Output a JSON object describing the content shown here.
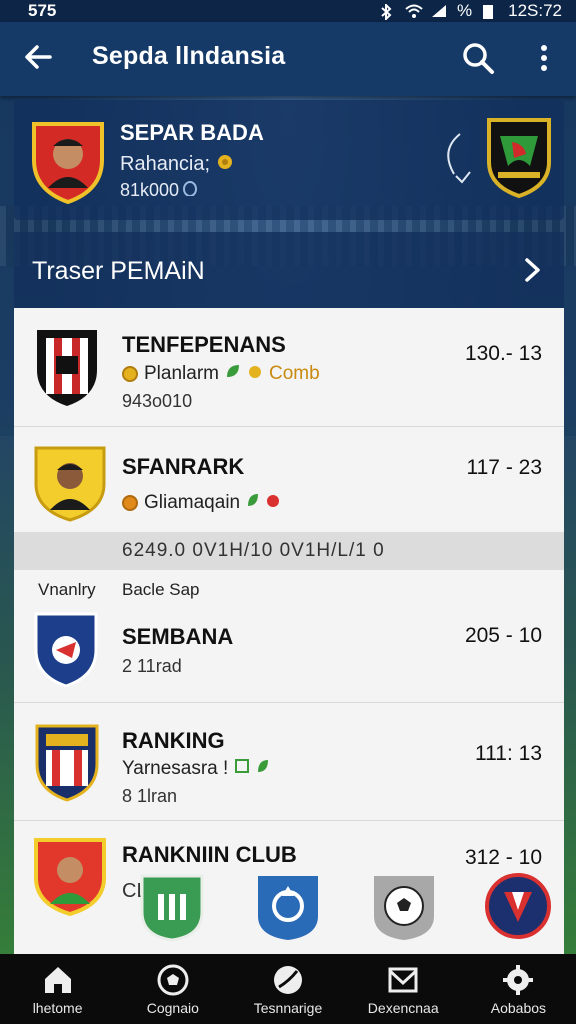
{
  "status_bar": {
    "left": "575",
    "battery_pct": "%",
    "time": "12S:72"
  },
  "app_bar": {
    "title": "Sepda llndansia"
  },
  "featured_match": {
    "team_name": "SEPAR BADA",
    "subtitle": "Rahancia;",
    "meta": "81k000"
  },
  "section": {
    "label": "Traser PEMAiN"
  },
  "list": [
    {
      "name": "TENFEPENANS",
      "sub_a": "Planlarm",
      "sub_b": "Comb",
      "meta": "943o010",
      "score": "130.- 13"
    },
    {
      "name": "SFANRARK",
      "sub_a": "Gliamaqain",
      "score": "117 - 23"
    }
  ],
  "strip_text": "6249.0   0V1H/10   0V1H/L/1 0",
  "column_headers": {
    "left": "Vnanlry",
    "right": "Bacle Sap"
  },
  "list_lower": [
    {
      "name": "SEMBANA",
      "meta": "2 11rad",
      "score": "205 - 10"
    },
    {
      "name": "RANKING",
      "sub_a": "Yarnesasra !",
      "meta": "8 1lran",
      "score": "111: 13"
    },
    {
      "name": "RANKNIIN CLUB",
      "meta": "CL",
      "score": "312 - 10"
    }
  ],
  "bottom_nav": [
    {
      "label": "lhetome",
      "icon": "home-icon"
    },
    {
      "label": "Cognaio",
      "icon": "ball-icon"
    },
    {
      "label": "Tesnnarige",
      "icon": "boot-icon"
    },
    {
      "label": "Dexencnaa",
      "icon": "mail-icon"
    },
    {
      "label": "Aobabos",
      "icon": "gear-icon"
    }
  ],
  "colors": {
    "appbar": "#163a68",
    "accent_yellow": "#e5b21f",
    "accent_green": "#3a9b3a",
    "accent_red": "#d93030"
  }
}
